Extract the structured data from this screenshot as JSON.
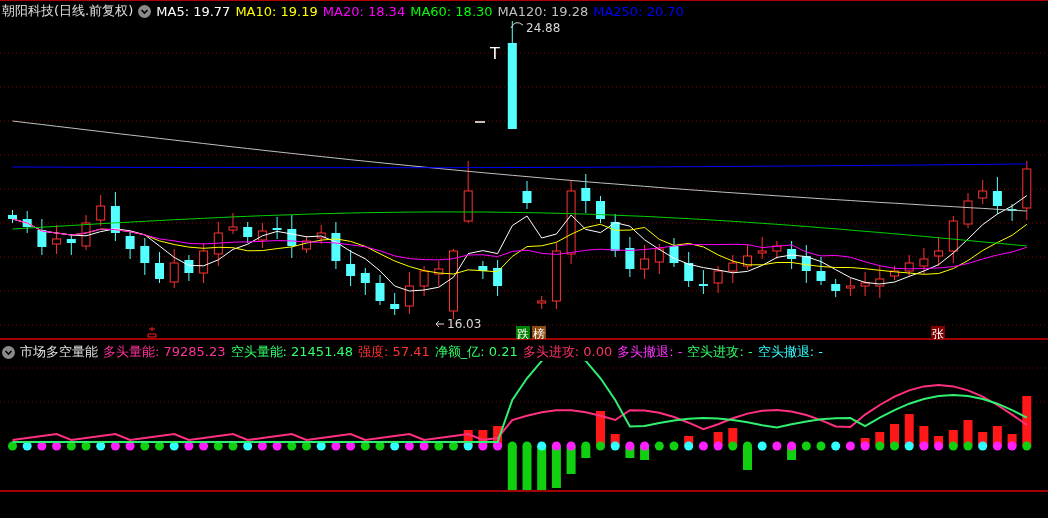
{
  "main_panel": {
    "title": "朝阳科技(日线.前复权)",
    "ma_legend": [
      {
        "label": "MA5: 19.77",
        "color": "#ffffff"
      },
      {
        "label": "MA10: 19.19",
        "color": "#ffff00"
      },
      {
        "label": "MA20: 18.34",
        "color": "#ff00ff"
      },
      {
        "label": "MA60: 18.30",
        "color": "#00ff00"
      },
      {
        "label": "MA120: 19.28",
        "color": "#c0c0c0"
      },
      {
        "label": "MA250: 20.70",
        "color": "#0000ff"
      }
    ],
    "high_label": "24.88",
    "low_label": "16.03",
    "pattern_mark": "T",
    "signal_badges": [
      {
        "text": "跌",
        "color": "#008000"
      },
      {
        "text": "榜",
        "color": "#8b4a10"
      },
      {
        "text": "张",
        "color": "#800000"
      }
    ]
  },
  "indicator_panel": {
    "title": "市场多空量能",
    "legend": [
      {
        "label": "多头量能: 79285.23",
        "color": "#ff3399"
      },
      {
        "label": "空头量能: 21451.48",
        "color": "#33ff66"
      },
      {
        "label": "强度: 57.41",
        "color": "#ff3333"
      },
      {
        "label": "净额_亿: 0.21",
        "color": "#33ff66"
      },
      {
        "label": "多头进攻: 0.00",
        "color": "#ff3366"
      },
      {
        "label": "多头撤退: -",
        "color": "#ff33ff"
      },
      {
        "label": "空头进攻: -",
        "color": "#33ff66"
      },
      {
        "label": "空头撤退: -",
        "color": "#33ffff"
      }
    ]
  }
}
